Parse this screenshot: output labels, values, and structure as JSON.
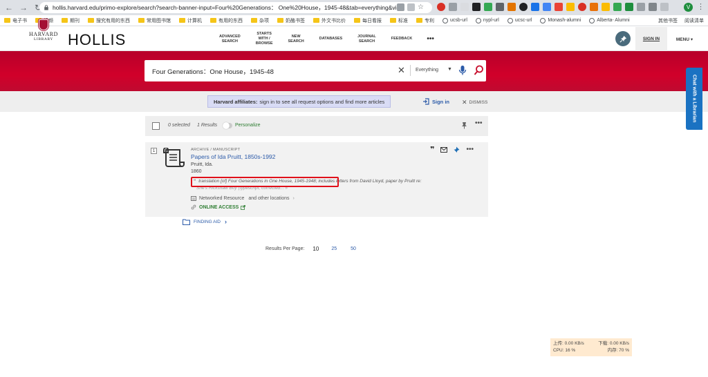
{
  "browser": {
    "url": "hollis.harvard.edu/primo-explore/search?search-banner-input=Four%20Generations： One%20House，1945-48&tab=everything&vid=...",
    "bookmarks": [
      "电子书",
      "视频",
      "期刊",
      "搜究有用的东西",
      "常用图书馆",
      "计算机",
      "有用的东西",
      "杂项",
      "奶酪书签",
      "外文书比价",
      "每日看报",
      "标准",
      "专利",
      "ucsb-url",
      "nypl-url",
      "ucsc-url",
      "Monash-alumni",
      "Alberta- Alumni"
    ],
    "bookmarks_right": [
      "其他书签",
      "阅读清单"
    ],
    "avatar_letter": "V"
  },
  "header": {
    "logo_line1": "HARVARD",
    "logo_line2": "LIBRARY",
    "title": "HOLLIS",
    "nav": [
      "ADVANCED\nSEARCH",
      "STARTS\nWITH /\nBROWSE",
      "NEW\nSEARCH",
      "DATABASES",
      "JOURNAL\nSEARCH",
      "FEEDBACK"
    ],
    "more": "•••",
    "sign_in": "SIGN IN",
    "menu": "MENU ▾"
  },
  "search": {
    "query": "Four Generations：One House，1945-48",
    "scope": "Everything"
  },
  "affiliates": {
    "bold": "Harvard affiliates:",
    "text": "sign in to see all request options and find more articles",
    "sign_in": "Sign in",
    "dismiss": "DISMISS"
  },
  "toolbar": {
    "selected": "0 selected",
    "results": "1 Results",
    "personalize": "Personalize",
    "more": "•••"
  },
  "result": {
    "number": "1",
    "type": "ARCHIVE / MANUSCRIPT",
    "title": "Papers of Ida Pruitt, 1850s-1992",
    "author": "Pruitt, Ida.",
    "year": "1860",
    "snippet_highlight": "translation [of] Four Generations in One House, 1945-1948",
    "snippet_rest": "; includes letters from David Lloyd, paper by Pruitt re:",
    "snippet_line2": "She's Rickshaw Boy (typescript, corrected... »",
    "networked": "Networked Resource",
    "other_locations": "and other locations",
    "online_access": "ONLINE ACCESS",
    "finding_aid": "FINDING AID"
  },
  "pagination": {
    "label": "Results Per Page:",
    "options": [
      "10",
      "25",
      "50"
    ]
  },
  "chat": {
    "label": "Chat with a Librarian"
  },
  "netmon": {
    "up": "上传: 0.00 KB/s",
    "down": "下载: 0.00 KB/s",
    "cpu": "CPU: 16 %",
    "mem": "内存: 70 %"
  },
  "colors": {
    "banner_red": "#c8102e",
    "harvard_crimson": "#a41034",
    "link_blue": "#2b5aa8",
    "green": "#2e7d32",
    "chat_blue": "#1a72c2"
  }
}
